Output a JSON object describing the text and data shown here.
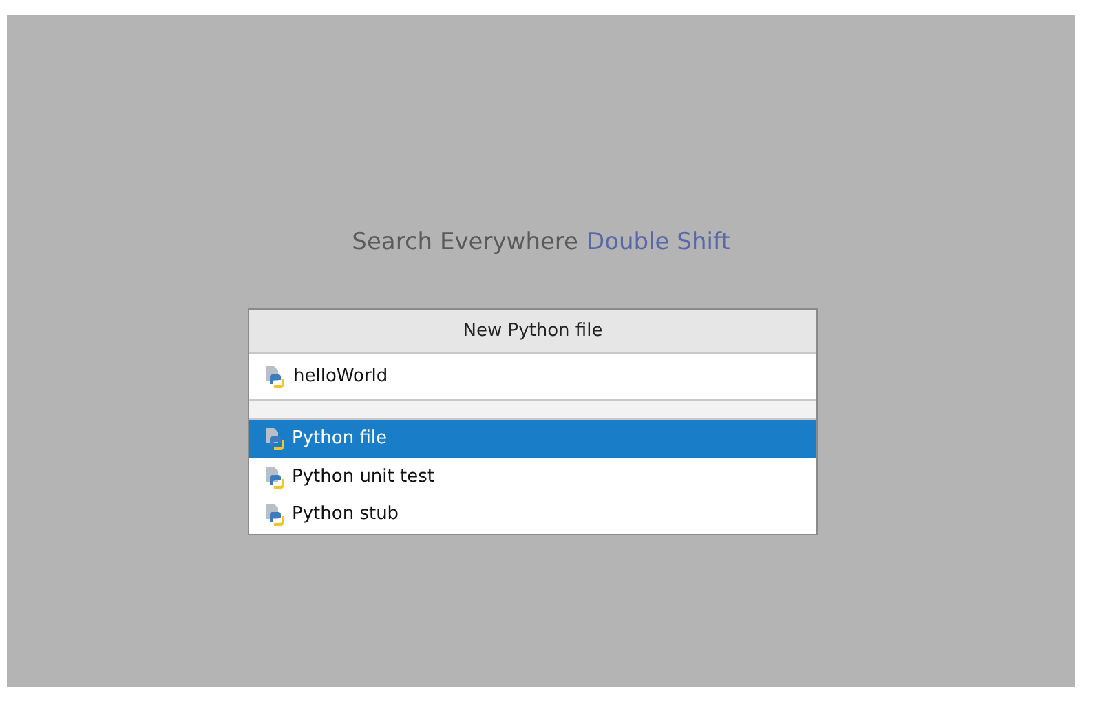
{
  "hints": [
    {
      "label": "Search Everywhere",
      "shortcut": "Double Shift"
    }
  ],
  "dialog": {
    "title": "New Python file",
    "name_field": {
      "value": "helloWorld"
    },
    "templates": [
      {
        "label": "Python file",
        "selected": true
      },
      {
        "label": "Python unit test",
        "selected": false
      },
      {
        "label": "Python stub",
        "selected": false
      }
    ]
  }
}
